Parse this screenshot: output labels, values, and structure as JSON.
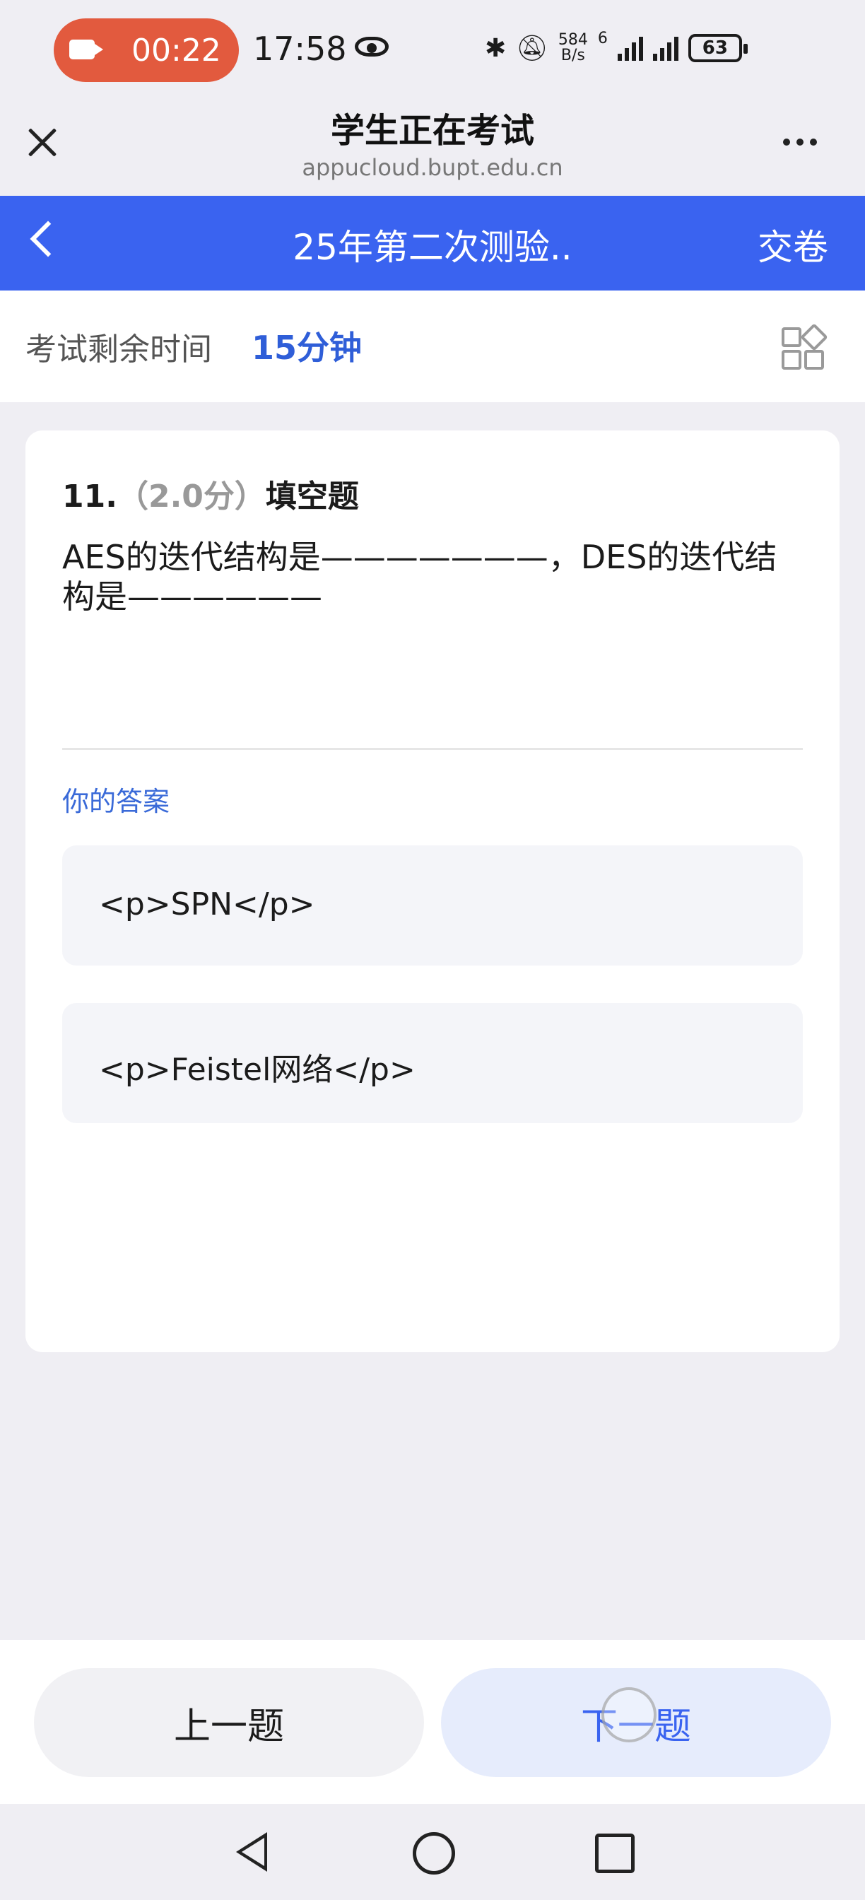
{
  "status_bar": {
    "record_time": "00:22",
    "clock": "17:58",
    "net_speed_value": "584",
    "net_speed_unit": "B/s",
    "wifi_label": "6",
    "battery": "63"
  },
  "browser": {
    "title": "学生正在考试",
    "url": "appucloud.bupt.edu.cn"
  },
  "header": {
    "exam_name": "25年第二次测验..",
    "submit_label": "交卷"
  },
  "timer": {
    "label": "考试剩余时间",
    "value": "15分钟"
  },
  "question": {
    "number": "11.",
    "score": "（2.0分）",
    "type": "填空题",
    "text": "AES的迭代结构是———————，DES的迭代结构是——————",
    "answer_label": "你的答案",
    "answers": [
      "<p>SPN</p>",
      "<p>Feistel网络</p>"
    ]
  },
  "nav": {
    "prev_label": "上一题",
    "next_label": "下一题"
  },
  "colors": {
    "accent": "#3a63f0",
    "record": "#e25a3e",
    "answer_label": "#3a6ad8"
  }
}
